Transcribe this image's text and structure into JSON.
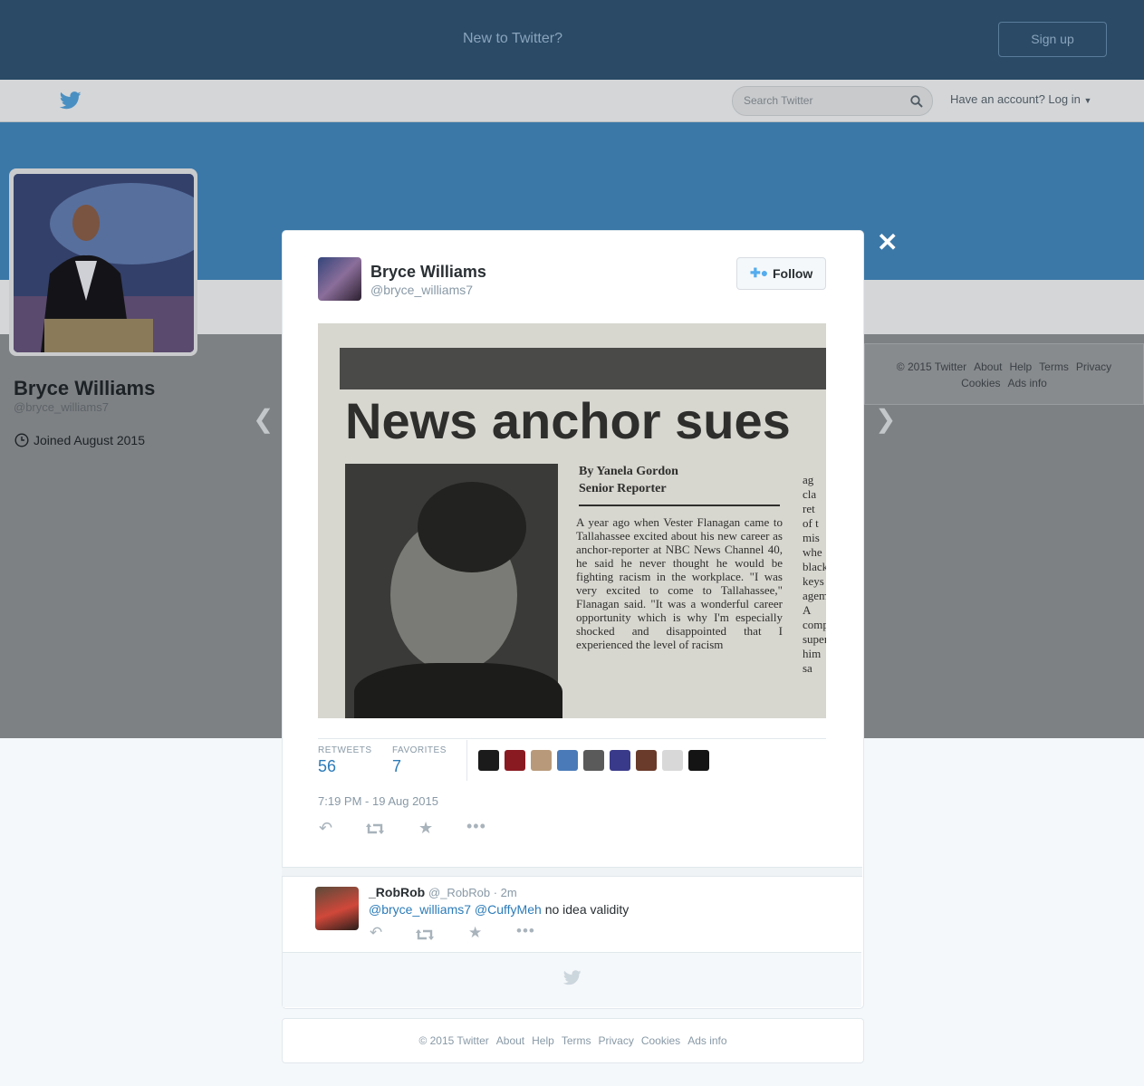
{
  "signup": {
    "message": "New to Twitter?",
    "button": "Sign up"
  },
  "nav": {
    "search_placeholder": "Search Twitter",
    "login": "Have an account? Log in"
  },
  "profile": {
    "name": "Bryce Williams",
    "handle": "@bryce_williams7",
    "joined": "Joined August 2015"
  },
  "sidebar_footer": [
    "© 2015 Twitter",
    "About",
    "Help",
    "Terms",
    "Privacy",
    "Cookies",
    "Ads info"
  ],
  "tweet": {
    "author_name": "Bryce Williams",
    "author_handle": "@bryce_williams7",
    "follow_label": "Follow",
    "photo": {
      "headline": "News anchor sues",
      "byline": "By Yanela Gordon",
      "byline_role": "Senior Reporter",
      "body": "A year ago when Vester Flanagan came to Tallahassee excited about his new career as anchor-reporter at NBC News Channel 40, he said he never thought he would be fighting racism in the workplace. \"I was very excited to come to Tallahassee,\" Flanagan said. \"It was a wonderful career opportunity which is why I'm especially shocked and disappointed that I experienced the level of racism",
      "side_col": [
        "ag",
        "cla",
        "ret",
        "of t",
        "mis",
        "whe",
        "black",
        "keys",
        "agem",
        "A",
        "comp",
        "super",
        "him sa"
      ]
    },
    "retweets_label": "RETWEETS",
    "retweets": "56",
    "favorites_label": "FAVORITES",
    "favorites": "7",
    "favoriter_colors": [
      "#1b1b1b",
      "#8a1a22",
      "#b89a7a",
      "#4a7ab8",
      "#5a5a5a",
      "#3a3a8a",
      "#6a3a2a",
      "#d8d8d8",
      "#141414"
    ],
    "timestamp": "7:19 PM - 19 Aug 2015"
  },
  "reply": {
    "name": "_RobRob",
    "meta": "@_RobRob · 2m",
    "mention1": "@bryce_williams7",
    "mention2": "@CuffyMeh",
    "text": "no idea validity"
  },
  "footer": [
    "© 2015 Twitter",
    "About",
    "Help",
    "Terms",
    "Privacy",
    "Cookies",
    "Ads info"
  ]
}
